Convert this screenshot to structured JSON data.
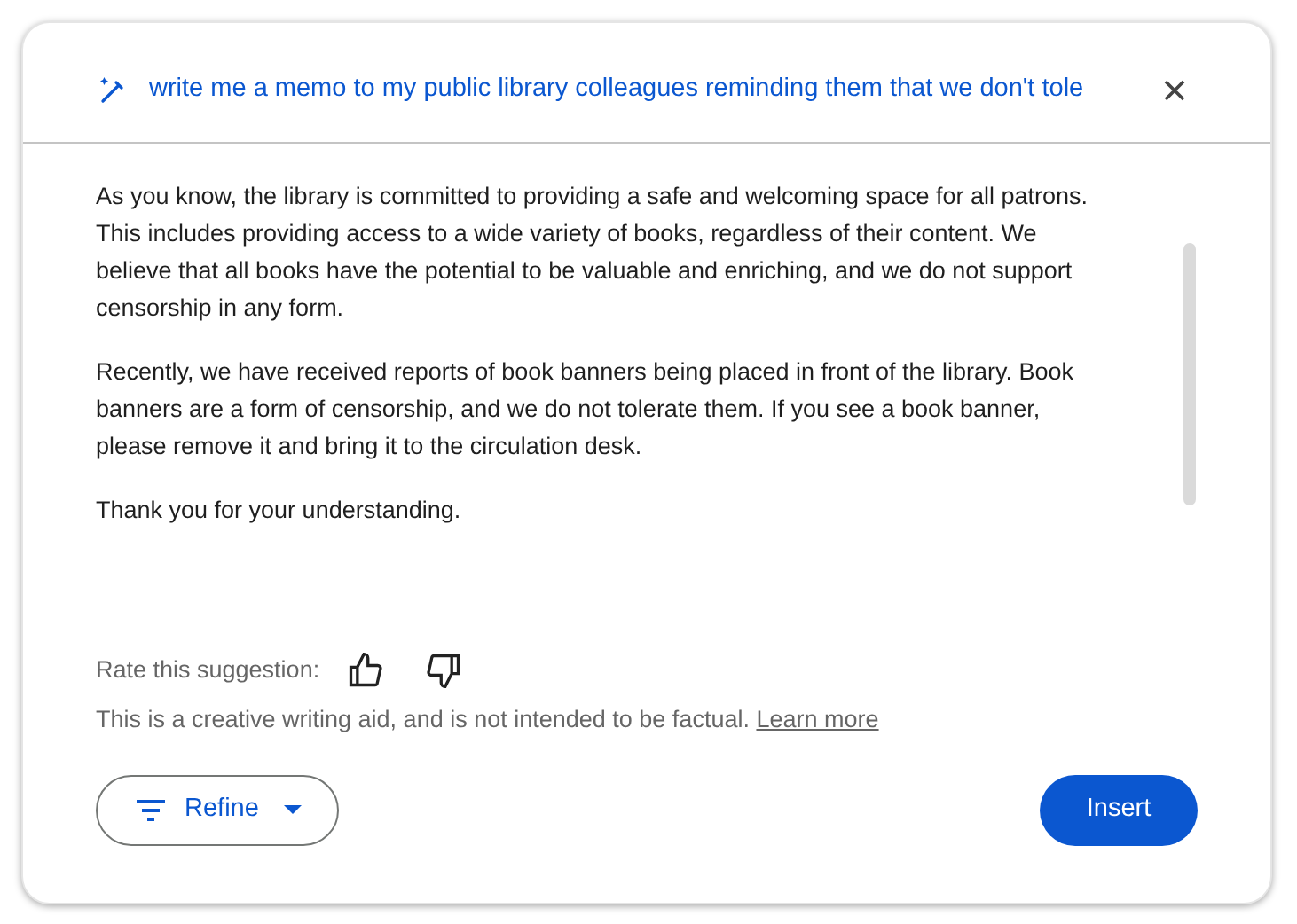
{
  "prompt": "write me a memo to my public library colleagues reminding them that we don't tole",
  "paragraphs": [
    "As you know, the library is committed to providing a safe and welcoming space for all patrons. This includes providing access to a wide variety of books, regardless of their content. We believe that all books have the potential to be valuable and enriching, and we do not support censorship in any form.",
    "Recently, we have received reports of book banners being placed in front of the library. Book banners are a form of censorship, and we do not tolerate them. If you see a book banner, please remove it and bring it to the circulation desk.",
    "Thank you for your understanding."
  ],
  "rating": {
    "label": "Rate this suggestion:"
  },
  "disclaimer": {
    "text": "This is a creative writing aid, and is not intended to be factual.",
    "link": "Learn more"
  },
  "buttons": {
    "refine": "Refine",
    "insert": "Insert"
  }
}
